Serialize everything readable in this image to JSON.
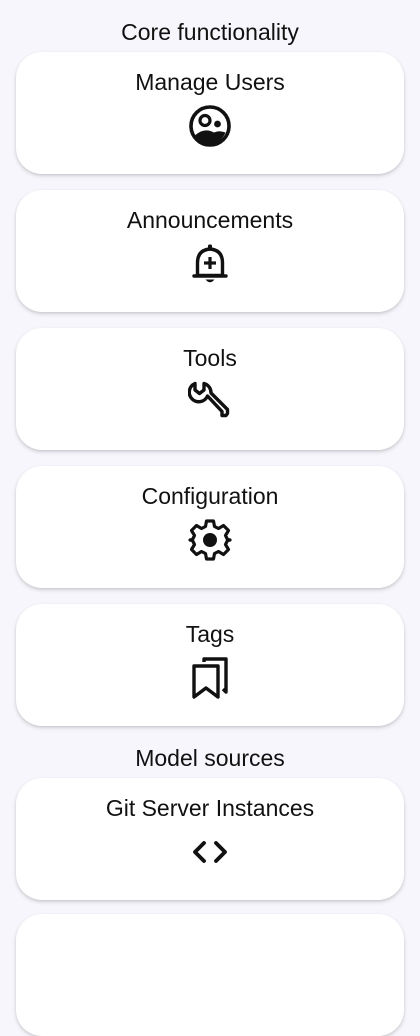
{
  "sections": [
    {
      "title": "Core functionality",
      "items": [
        {
          "label": "Manage Users",
          "icon": "manage-users-icon"
        },
        {
          "label": "Announcements",
          "icon": "bell-plus-icon"
        },
        {
          "label": "Tools",
          "icon": "wrench-icon"
        },
        {
          "label": "Configuration",
          "icon": "gear-icon"
        },
        {
          "label": "Tags",
          "icon": "bookmarks-icon"
        }
      ]
    },
    {
      "title": "Model sources",
      "items": [
        {
          "label": "Git Server Instances",
          "icon": "code-brackets-icon"
        }
      ]
    }
  ],
  "colors": {
    "background": "#f7f6fc",
    "card": "#ffffff",
    "text": "#111111",
    "icon": "#111111"
  }
}
